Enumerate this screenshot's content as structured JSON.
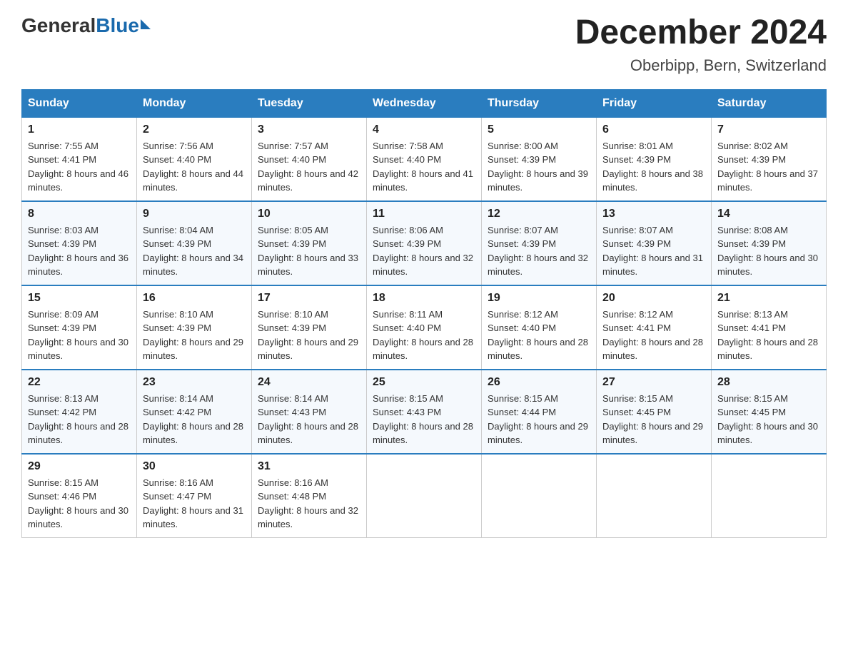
{
  "header": {
    "logo": {
      "general": "General",
      "blue": "Blue"
    },
    "title": "December 2024",
    "location": "Oberbipp, Bern, Switzerland"
  },
  "calendar": {
    "days_of_week": [
      "Sunday",
      "Monday",
      "Tuesday",
      "Wednesday",
      "Thursday",
      "Friday",
      "Saturday"
    ],
    "weeks": [
      [
        {
          "day": "1",
          "sunrise": "7:55 AM",
          "sunset": "4:41 PM",
          "daylight": "8 hours and 46 minutes."
        },
        {
          "day": "2",
          "sunrise": "7:56 AM",
          "sunset": "4:40 PM",
          "daylight": "8 hours and 44 minutes."
        },
        {
          "day": "3",
          "sunrise": "7:57 AM",
          "sunset": "4:40 PM",
          "daylight": "8 hours and 42 minutes."
        },
        {
          "day": "4",
          "sunrise": "7:58 AM",
          "sunset": "4:40 PM",
          "daylight": "8 hours and 41 minutes."
        },
        {
          "day": "5",
          "sunrise": "8:00 AM",
          "sunset": "4:39 PM",
          "daylight": "8 hours and 39 minutes."
        },
        {
          "day": "6",
          "sunrise": "8:01 AM",
          "sunset": "4:39 PM",
          "daylight": "8 hours and 38 minutes."
        },
        {
          "day": "7",
          "sunrise": "8:02 AM",
          "sunset": "4:39 PM",
          "daylight": "8 hours and 37 minutes."
        }
      ],
      [
        {
          "day": "8",
          "sunrise": "8:03 AM",
          "sunset": "4:39 PM",
          "daylight": "8 hours and 36 minutes."
        },
        {
          "day": "9",
          "sunrise": "8:04 AM",
          "sunset": "4:39 PM",
          "daylight": "8 hours and 34 minutes."
        },
        {
          "day": "10",
          "sunrise": "8:05 AM",
          "sunset": "4:39 PM",
          "daylight": "8 hours and 33 minutes."
        },
        {
          "day": "11",
          "sunrise": "8:06 AM",
          "sunset": "4:39 PM",
          "daylight": "8 hours and 32 minutes."
        },
        {
          "day": "12",
          "sunrise": "8:07 AM",
          "sunset": "4:39 PM",
          "daylight": "8 hours and 32 minutes."
        },
        {
          "day": "13",
          "sunrise": "8:07 AM",
          "sunset": "4:39 PM",
          "daylight": "8 hours and 31 minutes."
        },
        {
          "day": "14",
          "sunrise": "8:08 AM",
          "sunset": "4:39 PM",
          "daylight": "8 hours and 30 minutes."
        }
      ],
      [
        {
          "day": "15",
          "sunrise": "8:09 AM",
          "sunset": "4:39 PM",
          "daylight": "8 hours and 30 minutes."
        },
        {
          "day": "16",
          "sunrise": "8:10 AM",
          "sunset": "4:39 PM",
          "daylight": "8 hours and 29 minutes."
        },
        {
          "day": "17",
          "sunrise": "8:10 AM",
          "sunset": "4:39 PM",
          "daylight": "8 hours and 29 minutes."
        },
        {
          "day": "18",
          "sunrise": "8:11 AM",
          "sunset": "4:40 PM",
          "daylight": "8 hours and 28 minutes."
        },
        {
          "day": "19",
          "sunrise": "8:12 AM",
          "sunset": "4:40 PM",
          "daylight": "8 hours and 28 minutes."
        },
        {
          "day": "20",
          "sunrise": "8:12 AM",
          "sunset": "4:41 PM",
          "daylight": "8 hours and 28 minutes."
        },
        {
          "day": "21",
          "sunrise": "8:13 AM",
          "sunset": "4:41 PM",
          "daylight": "8 hours and 28 minutes."
        }
      ],
      [
        {
          "day": "22",
          "sunrise": "8:13 AM",
          "sunset": "4:42 PM",
          "daylight": "8 hours and 28 minutes."
        },
        {
          "day": "23",
          "sunrise": "8:14 AM",
          "sunset": "4:42 PM",
          "daylight": "8 hours and 28 minutes."
        },
        {
          "day": "24",
          "sunrise": "8:14 AM",
          "sunset": "4:43 PM",
          "daylight": "8 hours and 28 minutes."
        },
        {
          "day": "25",
          "sunrise": "8:15 AM",
          "sunset": "4:43 PM",
          "daylight": "8 hours and 28 minutes."
        },
        {
          "day": "26",
          "sunrise": "8:15 AM",
          "sunset": "4:44 PM",
          "daylight": "8 hours and 29 minutes."
        },
        {
          "day": "27",
          "sunrise": "8:15 AM",
          "sunset": "4:45 PM",
          "daylight": "8 hours and 29 minutes."
        },
        {
          "day": "28",
          "sunrise": "8:15 AM",
          "sunset": "4:45 PM",
          "daylight": "8 hours and 30 minutes."
        }
      ],
      [
        {
          "day": "29",
          "sunrise": "8:15 AM",
          "sunset": "4:46 PM",
          "daylight": "8 hours and 30 minutes."
        },
        {
          "day": "30",
          "sunrise": "8:16 AM",
          "sunset": "4:47 PM",
          "daylight": "8 hours and 31 minutes."
        },
        {
          "day": "31",
          "sunrise": "8:16 AM",
          "sunset": "4:48 PM",
          "daylight": "8 hours and 32 minutes."
        },
        null,
        null,
        null,
        null
      ]
    ]
  }
}
